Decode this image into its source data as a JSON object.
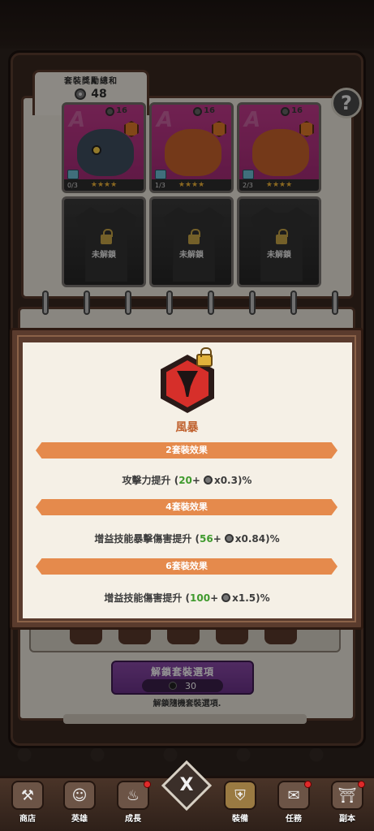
{
  "reward": {
    "title": "套裝獎勵總和",
    "value": "48"
  },
  "help": {
    "label": "?"
  },
  "cards": [
    {
      "count": "0/3",
      "level": "16",
      "stars": "★★★★",
      "tone": "dark"
    },
    {
      "count": "1/3",
      "level": "16",
      "stars": "★★★★",
      "tone": "orange"
    },
    {
      "count": "2/3",
      "level": "16",
      "stars": "★★★★",
      "tone": "orange"
    }
  ],
  "locked_slots": [
    {
      "label": "未解鎖"
    },
    {
      "label": "未解鎖"
    },
    {
      "label": "未解鎖"
    }
  ],
  "modal": {
    "set_name": "風暴",
    "effects": [
      {
        "header": "2套裝效果",
        "prefix": "攻擊力提升 (",
        "base": "20",
        "plus": " + ",
        "mult": "x0.3)%"
      },
      {
        "header": "4套裝效果",
        "prefix": "增益技能暴擊傷害提升 (",
        "base": "56",
        "plus": " + ",
        "mult": "x0.84)%"
      },
      {
        "header": "6套裝效果",
        "prefix": "增益技能傷害提升 (",
        "base": "100",
        "plus": " + ",
        "mult": "x1.5)%"
      }
    ]
  },
  "unlock": {
    "label": "解鎖套裝選項",
    "cost": "30",
    "desc": "解鎖隨機套裝選項."
  },
  "close": {
    "label": "X"
  },
  "nav": [
    {
      "label": "商店",
      "icon": "shop-icon",
      "glyph": "⚒",
      "badge": false
    },
    {
      "label": "英雄",
      "icon": "hero-icon",
      "glyph": "☺",
      "badge": false
    },
    {
      "label": "成長",
      "icon": "growth-icon",
      "glyph": "♨",
      "badge": true
    },
    {
      "label": "裝備",
      "icon": "equipment-icon",
      "glyph": "⛨",
      "badge": false
    },
    {
      "label": "任務",
      "icon": "quest-icon",
      "glyph": "✉",
      "badge": true
    },
    {
      "label": "副本",
      "icon": "dungeon-icon",
      "glyph": "⛩",
      "badge": true
    }
  ],
  "colors": {
    "accent": "#e58a4c",
    "set_title": "#c0622f",
    "bonus_green": "#3f9a2d",
    "unlock_purple": "#7a3e98"
  }
}
